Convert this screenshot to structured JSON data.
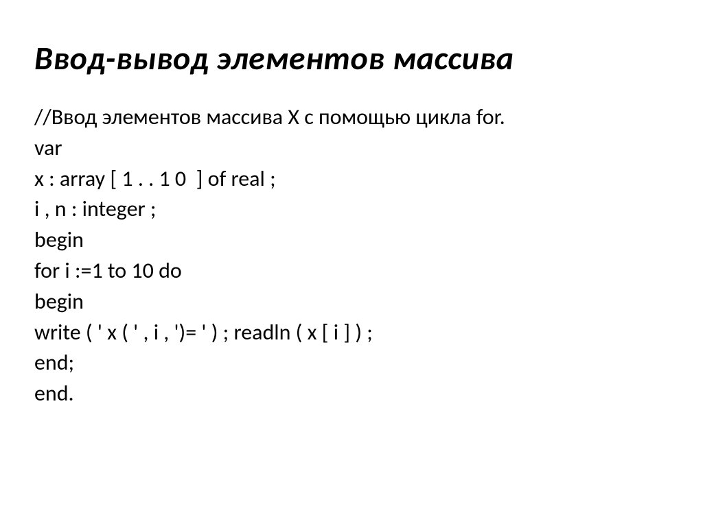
{
  "title": "Ввод-вывод элементов массива",
  "code": {
    "lines": [
      "//Ввод элементов массива Х с помощью цикла for.",
      "var",
      "x : array [ 1 . . 1 0  ] of real ;",
      "i , n : integer ;",
      "begin",
      "for i :=1 to 10 do",
      "begin",
      "write ( ' x ( ' , i , ')= ' ) ; readln ( x [ i ] ) ;",
      "end;",
      "end."
    ]
  }
}
